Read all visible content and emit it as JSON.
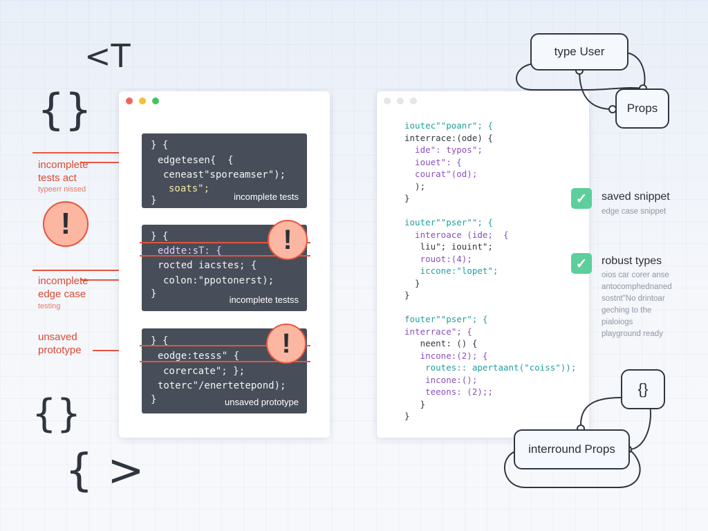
{
  "decor": {
    "top_glyph": "<T",
    "braces_1": "{}",
    "braces_2": "{}",
    "brace_arrow": "{ >"
  },
  "annotations": [
    {
      "label": "incomplete\ntests act",
      "sublabel": "typeerr nissed"
    },
    {
      "label": "incomplete\nedge case",
      "sublabel": "testing"
    },
    {
      "label": "unsaved\nprototype",
      "sublabel": ""
    }
  ],
  "left_window": {
    "blocks": [
      {
        "lines": [
          "} {",
          "edgetesen{  {",
          "ceneast\"sporeamser\");",
          "soats\";",
          "}"
        ],
        "caption": "incomplete tests",
        "warning": "!"
      },
      {
        "lines": [
          "} {",
          "eddte:sT: {",
          "rocted iacstes; {",
          "colon:\"ppotonerst);",
          "}"
        ],
        "caption": "incomplete testss",
        "warning": "!"
      },
      {
        "lines": [
          "} {",
          "eodge:tesss\" {",
          "corercate\"; };",
          "toterc\"/enertetepond);",
          "}"
        ],
        "caption": "unsaved prototype",
        "warning": "!"
      }
    ],
    "side_warning": "!"
  },
  "right_window": {
    "lines": [
      "iouteс\"\"poanr\"; {",
      "interrace:(ode) {",
      "  ide\": typos\";",
      "  iouet\": {",
      "  courat\"(od);",
      "  );",
      "}",
      "",
      "iouter\"\"pser\"\"; {",
      "  interoace (ide;  {",
      "   liu\"; iouint\";",
      "   rouot:(4);",
      "   iccone:\"lopet\";",
      "  }",
      "}",
      "",
      "fouter\"\"pser\"; {",
      "interrace\"; {",
      "   neent: () {",
      "   incone:(2); {",
      "    routes:: apertaant(\"coiss\"));",
      "    incone:();",
      "    teeons: (2);;",
      "   }",
      "}"
    ]
  },
  "checks": [
    {
      "title": "saved snippet",
      "desc": "edge case snippet"
    },
    {
      "title": "robust types",
      "desc": "oios car corer anse\nantocomphednaned\nsostnt\"No drintoar\ngeching to the\npialoiogs\nplayground ready"
    }
  ],
  "check_icon": "✓",
  "nodes": {
    "type_user": "type User",
    "props": "Props",
    "braces": "{}",
    "interround": "interround Props"
  },
  "colors": {
    "accent_red": "#e8543e",
    "ok_green": "#5ccf9a",
    "code_bg": "#474e59",
    "dot_red": "#f2645a",
    "dot_yellow": "#f5bd3b",
    "dot_green": "#46c363",
    "dot_gray": "#e4e6ea",
    "syntax_teal": "#1f9f9c",
    "syntax_purple": "#8a4fc0",
    "syntax_ink": "#2f3540"
  }
}
